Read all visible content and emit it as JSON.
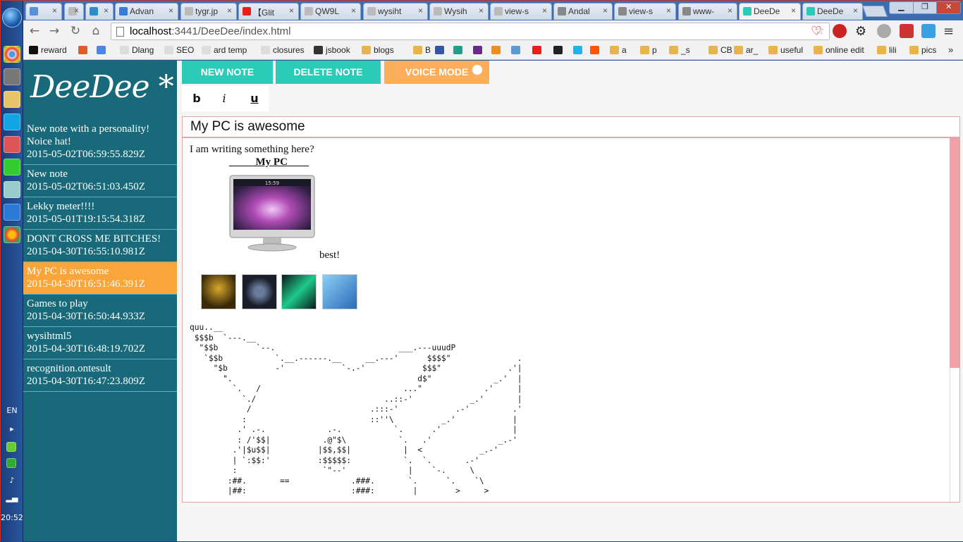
{
  "browser": {
    "tabs": [
      {
        "label": "",
        "icon": "loop-icon",
        "color": "#5b8fd8"
      },
      {
        "label": "",
        "icon": "page-icon",
        "color": "#bbbbbb"
      },
      {
        "label": "",
        "icon": "compass-icon",
        "color": "#2a8fc8"
      },
      {
        "label": "Advan",
        "icon": "home-icon",
        "color": "#3a7bd5"
      },
      {
        "label": "tygr.jp",
        "icon": "page-icon",
        "color": "#bbbbbb"
      },
      {
        "label": "【Glit",
        "icon": "youtube-icon",
        "color": "#e62117"
      },
      {
        "label": "QW9L",
        "icon": "page-icon",
        "color": "#bbbbbb"
      },
      {
        "label": "wysiht",
        "icon": "page-icon",
        "color": "#bbbbbb"
      },
      {
        "label": "Wysih",
        "icon": "page-icon",
        "color": "#bbbbbb"
      },
      {
        "label": "view-s",
        "icon": "page-icon",
        "color": "#bbbbbb"
      },
      {
        "label": "Andal",
        "icon": "btu-icon",
        "color": "#888888"
      },
      {
        "label": "view-s",
        "icon": "btu-icon",
        "color": "#888888"
      },
      {
        "label": "www-",
        "icon": "btu-icon",
        "color": "#888888"
      },
      {
        "label": "DeeDe",
        "icon": "deedee-icon",
        "color": "#2ccbb8",
        "active": true
      },
      {
        "label": "DeeDe",
        "icon": "deedee-icon",
        "color": "#2ccbb8"
      }
    ],
    "url_host": "localhost",
    "url_path": ":3441/DeeDee/index.html",
    "bookmarks": [
      {
        "label": "reward",
        "color": "#111111"
      },
      {
        "label": "",
        "color": "#e05a2a"
      },
      {
        "label": "",
        "color": "#4a86e8"
      },
      {
        "label": "Dlang",
        "color": "#dddddd"
      },
      {
        "label": "SEO",
        "color": "#dddddd"
      },
      {
        "label": "ard temp",
        "color": "#dddddd"
      },
      {
        "label": "closures",
        "color": "#dddddd"
      },
      {
        "label": "jsbook",
        "color": "#333333"
      },
      {
        "label": "blogs",
        "color": "#e8b54a"
      },
      {
        "label": "B",
        "color": "#e8b54a"
      },
      {
        "label": "",
        "color": "#3355aa"
      },
      {
        "label": "",
        "color": "#1aa38a"
      },
      {
        "label": "",
        "color": "#6a2a8a"
      },
      {
        "label": "",
        "color": "#f28c1e"
      },
      {
        "label": "",
        "color": "#5b9bd5"
      },
      {
        "label": "",
        "color": "#e62117"
      },
      {
        "label": "",
        "color": "#222222"
      },
      {
        "label": "",
        "color": "#1ab7ea"
      },
      {
        "label": "",
        "color": "#ff5500"
      },
      {
        "label": "a",
        "color": "#e8b54a"
      },
      {
        "label": "p",
        "color": "#e8b54a"
      },
      {
        "label": "_s",
        "color": "#e8b54a"
      },
      {
        "label": "CB",
        "color": "#e8b54a"
      },
      {
        "label": "ar_",
        "color": "#e8b54a"
      },
      {
        "label": "useful",
        "color": "#e8b54a"
      },
      {
        "label": "online edit",
        "color": "#e8b54a"
      },
      {
        "label": "lili",
        "color": "#e8b54a"
      },
      {
        "label": "pics",
        "color": "#e8b54a"
      }
    ]
  },
  "taskbar": {
    "language": "EN",
    "clock": "20:52"
  },
  "app": {
    "brand": "DeeDee *",
    "toolbar": {
      "new_note": "NEW NOTE",
      "delete_note": "DELETE NOTE",
      "voice_mode": "VOICE MODE"
    },
    "format": {
      "bold": "b",
      "italic": "i",
      "underline": "u"
    },
    "notes": [
      {
        "title": "New note with a personality! Noice hat!",
        "date": "2015-05-02T06:59:55.829Z"
      },
      {
        "title": "New note",
        "date": "2015-05-02T06:51:03.450Z"
      },
      {
        "title": "Lekky meter!!!!",
        "date": "2015-05-01T19:15:54.318Z"
      },
      {
        "title": "DONT CROSS ME BITCHES!",
        "date": "2015-04-30T16:55:10.981Z"
      },
      {
        "title": "My PC is awesome",
        "date": "2015-04-30T16:51:46.391Z",
        "active": true
      },
      {
        "title": "Games to play",
        "date": "2015-04-30T16:50:44.933Z"
      },
      {
        "title": "wysihtml5",
        "date": "2015-04-30T16:48:19.702Z"
      },
      {
        "title": "recognition.ontesult",
        "date": "2015-04-30T16:47:23.809Z"
      }
    ],
    "current_title": "My PC is awesome",
    "editor": {
      "line1": "I am writing something here?",
      "pc_heading": "_____My PC____",
      "monitor_time": "15:59",
      "best": "best!",
      "ascii_art": "quu..__\n $$$b  `---.__\n  \"$$b        `--.                          ___.---uuudP\n   `$$b           `.__.------.__     __.---'      $$$$\"              .\n     \"$b          -'            `-.-'            $$$\"              .'|\n       \".                                       d$\"             _.'  |\n         `.   /                              ...\"             .'     |\n           `./                           ..::-'            _.'       |\n            /                         .:::-'            .-'         .'\n           :                          ::''\\          _.'            |\n          .' .-.             .-.           `.      .'               |\n          : /'$$|           .@\"$\\           `.   .'              _.-'\n         .'|$u$$|          |$$,$$|           |  <            _.-'\n         | `:$$:'          :$$$$$:           `.  `.       .-'\n         :                  `\"--'             |    `-.     \\\n        :##.       ==             .###.       `.      `.    `\\\n        |##:                      :###:        |        >     >"
    }
  }
}
